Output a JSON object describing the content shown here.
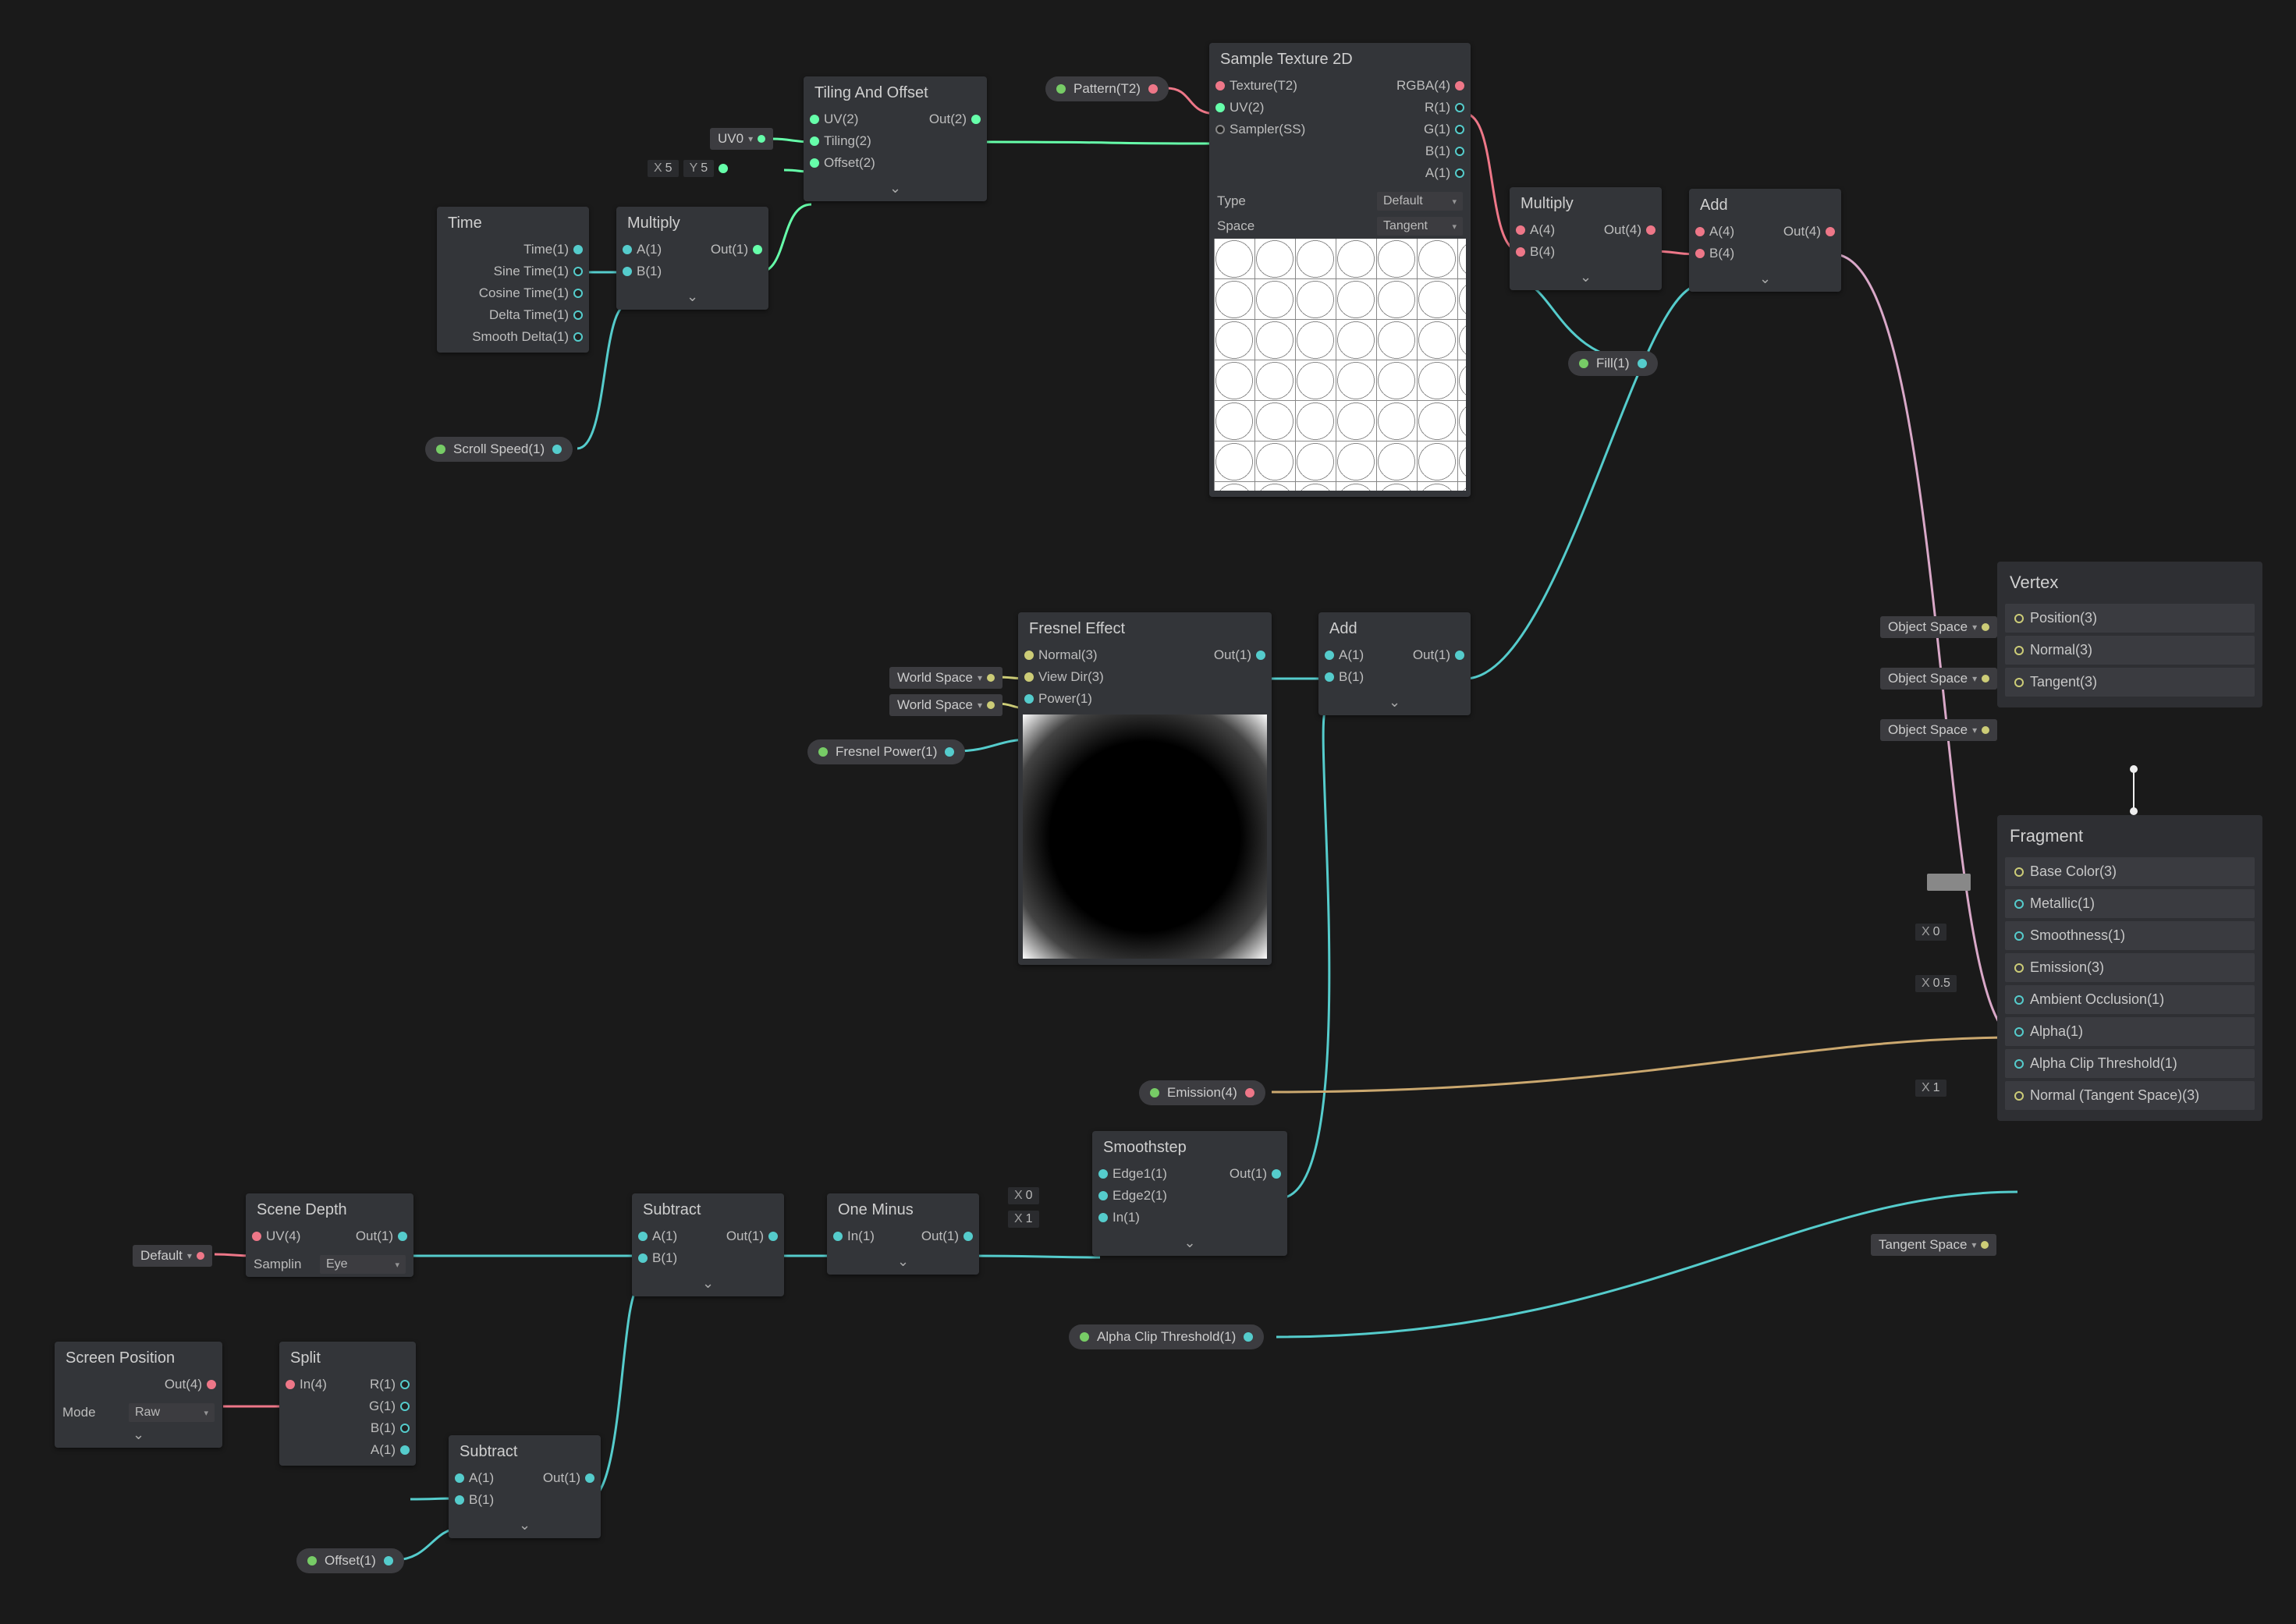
{
  "nodes": {
    "time": {
      "title": "Time",
      "outs": [
        "Time(1)",
        "Sine Time(1)",
        "Cosine Time(1)",
        "Delta Time(1)",
        "Smooth Delta(1)"
      ]
    },
    "multiply1": {
      "title": "Multiply",
      "ins": [
        "A(1)",
        "B(1)"
      ],
      "outs": [
        "Out(1)"
      ]
    },
    "tiling": {
      "title": "Tiling And Offset",
      "ins": [
        "UV(2)",
        "Tiling(2)",
        "Offset(2)"
      ],
      "outs": [
        "Out(2)"
      ]
    },
    "sample": {
      "title": "Sample Texture 2D",
      "ins": [
        "Texture(T2)",
        "UV(2)",
        "Sampler(SS)"
      ],
      "outs": [
        "RGBA(4)",
        "R(1)",
        "G(1)",
        "B(1)",
        "A(1)"
      ],
      "type_label": "Type",
      "type_value": "Default",
      "space_label": "Space",
      "space_value": "Tangent"
    },
    "multiply2": {
      "title": "Multiply",
      "ins": [
        "A(4)",
        "B(4)"
      ],
      "outs": [
        "Out(4)"
      ]
    },
    "add1": {
      "title": "Add",
      "ins": [
        "A(4)",
        "B(4)"
      ],
      "outs": [
        "Out(4)"
      ]
    },
    "fresnel": {
      "title": "Fresnel Effect",
      "ins": [
        "Normal(3)",
        "View Dir(3)",
        "Power(1)"
      ],
      "outs": [
        "Out(1)"
      ]
    },
    "add2": {
      "title": "Add",
      "ins": [
        "A(1)",
        "B(1)"
      ],
      "outs": [
        "Out(1)"
      ]
    },
    "scenedepth": {
      "title": "Scene Depth",
      "ins": [
        "UV(4)"
      ],
      "outs": [
        "Out(1)"
      ],
      "sampling_label": "Samplin",
      "sampling_value": "Eye"
    },
    "subtract1": {
      "title": "Subtract",
      "ins": [
        "A(1)",
        "B(1)"
      ],
      "outs": [
        "Out(1)"
      ]
    },
    "oneminus": {
      "title": "One Minus",
      "ins": [
        "In(1)"
      ],
      "outs": [
        "Out(1)"
      ]
    },
    "smoothstep": {
      "title": "Smoothstep",
      "ins": [
        "Edge1(1)",
        "Edge2(1)",
        "In(1)"
      ],
      "outs": [
        "Out(1)"
      ]
    },
    "screenpos": {
      "title": "Screen Position",
      "outs": [
        "Out(4)"
      ],
      "mode_label": "Mode",
      "mode_value": "Raw"
    },
    "split": {
      "title": "Split",
      "ins": [
        "In(4)"
      ],
      "outs": [
        "R(1)",
        "G(1)",
        "B(1)",
        "A(1)"
      ]
    },
    "subtract2": {
      "title": "Subtract",
      "ins": [
        "A(1)",
        "B(1)"
      ],
      "outs": [
        "Out(1)"
      ]
    }
  },
  "chips": {
    "scrollspeed": "Scroll Speed(1)",
    "pattern": "Pattern(T2)",
    "fill": "Fill(1)",
    "fresnelpower": "Fresnel Power(1)",
    "emission": "Emission(4)",
    "alphaclip": "Alpha Clip Threshold(1)",
    "offset": "Offset(1)"
  },
  "props": {
    "uv0": "UV0",
    "worldspace1": "World Space",
    "worldspace2": "World Space",
    "default_uv": "Default",
    "tilingX": {
      "label": "X",
      "value": "5"
    },
    "tilingY": {
      "label": "Y",
      "value": "5"
    },
    "edge1X": {
      "label": "X",
      "value": "0"
    },
    "edge2X": {
      "label": "X",
      "value": "1"
    },
    "objspace1": "Object Space",
    "objspace2": "Object Space",
    "objspace3": "Object Space",
    "metallicX": {
      "label": "X",
      "value": "0"
    },
    "smoothnessX": {
      "label": "X",
      "value": "0.5"
    },
    "aoX": {
      "label": "X",
      "value": "1"
    },
    "tangentspace": "Tangent Space"
  },
  "stacks": {
    "vertex": {
      "title": "Vertex",
      "rows": [
        "Position(3)",
        "Normal(3)",
        "Tangent(3)"
      ]
    },
    "fragment": {
      "title": "Fragment",
      "rows": [
        "Base Color(3)",
        "Metallic(1)",
        "Smoothness(1)",
        "Emission(3)",
        "Ambient Occlusion(1)",
        "Alpha(1)",
        "Alpha Clip Threshold(1)",
        "Normal (Tangent Space)(3)"
      ]
    }
  }
}
